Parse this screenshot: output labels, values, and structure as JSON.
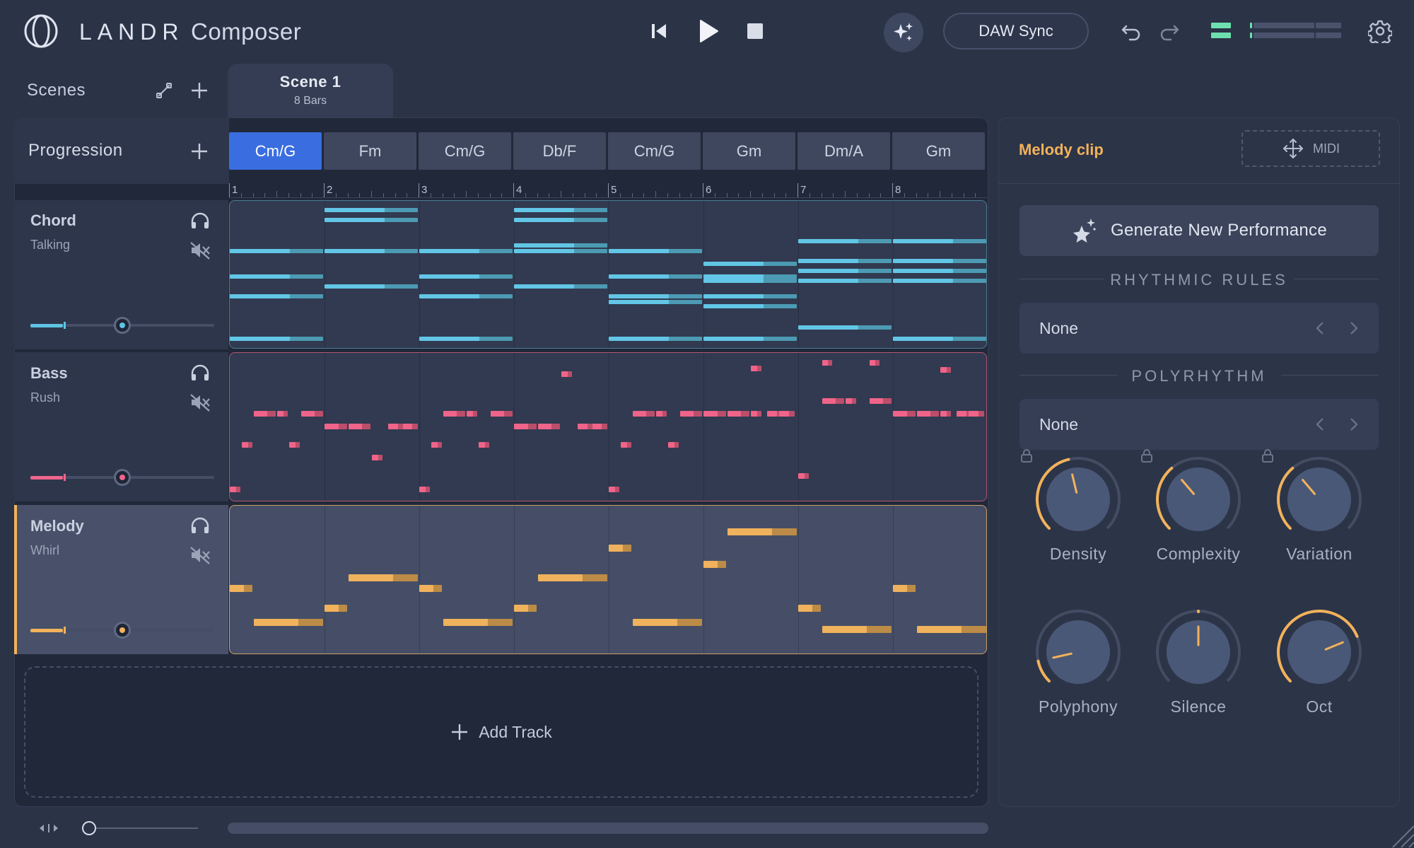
{
  "app": {
    "brand": "LANDR",
    "name": "Composer"
  },
  "toolbar": {
    "daw_sync_label": "DAW Sync"
  },
  "scenes": {
    "label": "Scenes",
    "active_scene": {
      "name": "Scene 1",
      "length": "8 Bars"
    }
  },
  "progression": {
    "label": "Progression",
    "chords": [
      "Cm/G",
      "Fm",
      "Cm/G",
      "Db/F",
      "Cm/G",
      "Gm",
      "Dm/A",
      "Gm"
    ],
    "active_index": 0,
    "bars": [
      "1",
      "2",
      "3",
      "4",
      "5",
      "6",
      "7",
      "8"
    ]
  },
  "tracks": [
    {
      "name": "Chord",
      "preset": "Talking",
      "color": "#5fc4e4",
      "note_color": "#62c6e6",
      "level": 0.5
    },
    {
      "name": "Bass",
      "preset": "Rush",
      "color": "#f0648c",
      "note_color": "#f0648a",
      "level": 0.5
    },
    {
      "name": "Melody",
      "preset": "Whirl",
      "color": "#f2b25b",
      "note_color": "#f0b25c",
      "level": 0.5
    }
  ],
  "add_track_label": "Add Track",
  "melody_panel": {
    "title": "Melody clip",
    "midi_label": "MIDI",
    "generate_label": "Generate New Performance",
    "rhythmic_rules": {
      "title": "RHYTHMIC RULES",
      "value": "None"
    },
    "polyrhythm": {
      "title": "POLYRHYTHM",
      "value": "None"
    },
    "knobs": [
      {
        "label": "Density",
        "value": 0.45,
        "locked": true
      },
      {
        "label": "Complexity",
        "value": 0.35,
        "locked": true
      },
      {
        "label": "Variation",
        "value": 0.35,
        "locked": true
      },
      {
        "label": "Polyphony",
        "value": 0.12,
        "locked": false
      },
      {
        "label": "Silence",
        "value": 0.5,
        "locked": false
      },
      {
        "label": "Oct",
        "value": 0.75,
        "locked": false
      }
    ]
  },
  "colors": {
    "accent": "#3a6ee0",
    "chord": "#5fc4e4",
    "bass": "#f0648c",
    "melody": "#f2b25b",
    "meter_green": "#6ee0b0"
  }
}
